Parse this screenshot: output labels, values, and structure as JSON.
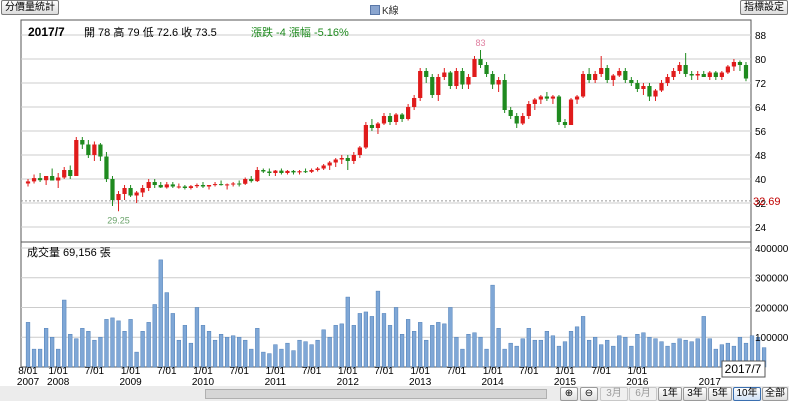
{
  "toolbar": {
    "left_button": "分價量統計",
    "right_button": "指標設定",
    "legend_label": "K線"
  },
  "header": {
    "period": "2017/7",
    "ohlc_text": "開 78  高 79  低 72.6  收 73.5",
    "change_text": "漲跌 -4  漲幅  -5.16%"
  },
  "volume_panel": {
    "label": "成交量 69,156 張"
  },
  "colors": {
    "up": "#e01b1b",
    "down": "#1f8a1f",
    "volume_bar": "#7fa7d6",
    "grid": "#cccccc"
  },
  "chart_data": [
    {
      "type": "candlestick",
      "title": "K線",
      "interval": "monthly",
      "price_axis_ticks": [
        24,
        32,
        40,
        48,
        56,
        64,
        72,
        80,
        88
      ],
      "ylim": [
        19,
        93
      ],
      "annotations": {
        "high": 83,
        "low": 29.25,
        "last_price": "32.69"
      },
      "x_tick_labels": [
        "8/01",
        "1/01",
        "7/01",
        "1/01",
        "7/01",
        "1/01",
        "7/01",
        "1/01",
        "7/01",
        "1/01",
        "7/01",
        "1/01",
        "7/01",
        "1/01",
        "7/01",
        "1/01",
        "7/01",
        "1/01"
      ],
      "x_year_labels": [
        "2007",
        "2008",
        "2009",
        "2010",
        "2011",
        "2012",
        "2013",
        "2014",
        "2015",
        "2016",
        "2017"
      ],
      "current_label": "2017/7",
      "candles": [
        {
          "d": "2007/08",
          "o": 38.5,
          "h": 40,
          "l": 37.5,
          "c": 39.2
        },
        {
          "d": "2007/09",
          "o": 39.2,
          "h": 41.5,
          "l": 38.5,
          "c": 40.3
        },
        {
          "d": "2007/10",
          "o": 40.3,
          "h": 42,
          "l": 39,
          "c": 39.6
        },
        {
          "d": "2007/11",
          "o": 39.6,
          "h": 41,
          "l": 38,
          "c": 41
        },
        {
          "d": "2007/12",
          "o": 41,
          "h": 43.5,
          "l": 40.5,
          "c": 39.5
        },
        {
          "d": "2008/01",
          "o": 39.5,
          "h": 42,
          "l": 37,
          "c": 40.5
        },
        {
          "d": "2008/02",
          "o": 40.5,
          "h": 44,
          "l": 40,
          "c": 43
        },
        {
          "d": "2008/03",
          "o": 43,
          "h": 44.5,
          "l": 40,
          "c": 41
        },
        {
          "d": "2008/04",
          "o": 41,
          "h": 54,
          "l": 41,
          "c": 53
        },
        {
          "d": "2008/05",
          "o": 53,
          "h": 54,
          "l": 50,
          "c": 51.5
        },
        {
          "d": "2008/06",
          "o": 51.5,
          "h": 53,
          "l": 47,
          "c": 48
        },
        {
          "d": "2008/07",
          "o": 48,
          "h": 52.5,
          "l": 46,
          "c": 51.5
        },
        {
          "d": "2008/08",
          "o": 51.5,
          "h": 52,
          "l": 46,
          "c": 47.5
        },
        {
          "d": "2008/09",
          "o": 47.5,
          "h": 49,
          "l": 39,
          "c": 40
        },
        {
          "d": "2008/10",
          "o": 40,
          "h": 41,
          "l": 31,
          "c": 33
        },
        {
          "d": "2008/11",
          "o": 33,
          "h": 36,
          "l": 29.25,
          "c": 35
        },
        {
          "d": "2008/12",
          "o": 35,
          "h": 38,
          "l": 33,
          "c": 37
        },
        {
          "d": "2009/01",
          "o": 37,
          "h": 38,
          "l": 34,
          "c": 34.5
        },
        {
          "d": "2009/02",
          "o": 34.5,
          "h": 36,
          "l": 32,
          "c": 35.5
        },
        {
          "d": "2009/03",
          "o": 35.5,
          "h": 38,
          "l": 34,
          "c": 37
        },
        {
          "d": "2009/04",
          "o": 37,
          "h": 40,
          "l": 36,
          "c": 39
        },
        {
          "d": "2009/05",
          "o": 39,
          "h": 40,
          "l": 37,
          "c": 38
        },
        {
          "d": "2009/06",
          "o": 38,
          "h": 39,
          "l": 37,
          "c": 37.2
        },
        {
          "d": "2009/07",
          "o": 37.2,
          "h": 39,
          "l": 36.8,
          "c": 38.2
        },
        {
          "d": "2009/08",
          "o": 38.2,
          "h": 39,
          "l": 37,
          "c": 37.5
        },
        {
          "d": "2009/09",
          "o": 37.5,
          "h": 38.5,
          "l": 36.8,
          "c": 37.5
        },
        {
          "d": "2009/10",
          "o": 37.5,
          "h": 38,
          "l": 36.5,
          "c": 37
        },
        {
          "d": "2009/11",
          "o": 37,
          "h": 38,
          "l": 36.5,
          "c": 37.6
        },
        {
          "d": "2009/12",
          "o": 37.6,
          "h": 38.5,
          "l": 37,
          "c": 38
        },
        {
          "d": "2010/01",
          "o": 38,
          "h": 39,
          "l": 37,
          "c": 37.5
        },
        {
          "d": "2010/02",
          "o": 37.5,
          "h": 38,
          "l": 36.5,
          "c": 38
        },
        {
          "d": "2010/03",
          "o": 38,
          "h": 39,
          "l": 37.5,
          "c": 38.3
        },
        {
          "d": "2010/04",
          "o": 38.3,
          "h": 39.5,
          "l": 37.8,
          "c": 38
        },
        {
          "d": "2010/05",
          "o": 38,
          "h": 38.5,
          "l": 36.5,
          "c": 38.2
        },
        {
          "d": "2010/06",
          "o": 38.2,
          "h": 39,
          "l": 37.5,
          "c": 38.5
        },
        {
          "d": "2010/07",
          "o": 38.5,
          "h": 39.5,
          "l": 37.5,
          "c": 38.4
        },
        {
          "d": "2010/08",
          "o": 38.4,
          "h": 40.5,
          "l": 38,
          "c": 40
        },
        {
          "d": "2010/09",
          "o": 40,
          "h": 41,
          "l": 38.8,
          "c": 39.3
        },
        {
          "d": "2010/10",
          "o": 39.3,
          "h": 44,
          "l": 39,
          "c": 43
        },
        {
          "d": "2010/11",
          "o": 43,
          "h": 43.5,
          "l": 42,
          "c": 42.5
        },
        {
          "d": "2010/12",
          "o": 42.5,
          "h": 43.5,
          "l": 41,
          "c": 42
        },
        {
          "d": "2011/01",
          "o": 42,
          "h": 43,
          "l": 41,
          "c": 42.8
        },
        {
          "d": "2011/02",
          "o": 42.8,
          "h": 43.5,
          "l": 41.5,
          "c": 42
        },
        {
          "d": "2011/03",
          "o": 42,
          "h": 43,
          "l": 41.5,
          "c": 42.7
        },
        {
          "d": "2011/04",
          "o": 42.7,
          "h": 43,
          "l": 41.5,
          "c": 42.2
        },
        {
          "d": "2011/05",
          "o": 42.2,
          "h": 43,
          "l": 41.5,
          "c": 42.6
        },
        {
          "d": "2011/06",
          "o": 42.6,
          "h": 43.5,
          "l": 42,
          "c": 42.4
        },
        {
          "d": "2011/07",
          "o": 42.4,
          "h": 43.5,
          "l": 42,
          "c": 43
        },
        {
          "d": "2011/08",
          "o": 43,
          "h": 44,
          "l": 42.5,
          "c": 43.5
        },
        {
          "d": "2011/09",
          "o": 43.5,
          "h": 45,
          "l": 43,
          "c": 44.5
        },
        {
          "d": "2011/10",
          "o": 44.5,
          "h": 46,
          "l": 43,
          "c": 45.5
        },
        {
          "d": "2011/11",
          "o": 45.5,
          "h": 47,
          "l": 44,
          "c": 46.5
        },
        {
          "d": "2011/12",
          "o": 46.5,
          "h": 48,
          "l": 45,
          "c": 47
        },
        {
          "d": "2012/01",
          "o": 47,
          "h": 48,
          "l": 43,
          "c": 46
        },
        {
          "d": "2012/02",
          "o": 46,
          "h": 49,
          "l": 45,
          "c": 48
        },
        {
          "d": "2012/03",
          "o": 48,
          "h": 51,
          "l": 47,
          "c": 50.5
        },
        {
          "d": "2012/04",
          "o": 50.5,
          "h": 59,
          "l": 50,
          "c": 58
        },
        {
          "d": "2012/05",
          "o": 58,
          "h": 60,
          "l": 56,
          "c": 57
        },
        {
          "d": "2012/06",
          "o": 57,
          "h": 59,
          "l": 55,
          "c": 58.5
        },
        {
          "d": "2012/07",
          "o": 58.5,
          "h": 62,
          "l": 58,
          "c": 61
        },
        {
          "d": "2012/08",
          "o": 61,
          "h": 62,
          "l": 58,
          "c": 59
        },
        {
          "d": "2012/09",
          "o": 59,
          "h": 62,
          "l": 58,
          "c": 61.5
        },
        {
          "d": "2012/10",
          "o": 61.5,
          "h": 62,
          "l": 59,
          "c": 60
        },
        {
          "d": "2012/11",
          "o": 60,
          "h": 65,
          "l": 59.5,
          "c": 64
        },
        {
          "d": "2012/12",
          "o": 64,
          "h": 68,
          "l": 63,
          "c": 67
        },
        {
          "d": "2013/01",
          "o": 67,
          "h": 77,
          "l": 66,
          "c": 76
        },
        {
          "d": "2013/02",
          "o": 76,
          "h": 77,
          "l": 72,
          "c": 74
        },
        {
          "d": "2013/03",
          "o": 74,
          "h": 75,
          "l": 67,
          "c": 68
        },
        {
          "d": "2013/04",
          "o": 68,
          "h": 75,
          "l": 66,
          "c": 74
        },
        {
          "d": "2013/05",
          "o": 74,
          "h": 77,
          "l": 73,
          "c": 75.5
        },
        {
          "d": "2013/06",
          "o": 75.5,
          "h": 76,
          "l": 70,
          "c": 71
        },
        {
          "d": "2013/07",
          "o": 71,
          "h": 77,
          "l": 70,
          "c": 76
        },
        {
          "d": "2013/08",
          "o": 76,
          "h": 77,
          "l": 70,
          "c": 71.5
        },
        {
          "d": "2013/09",
          "o": 71.5,
          "h": 75,
          "l": 70,
          "c": 74
        },
        {
          "d": "2013/10",
          "o": 74,
          "h": 81,
          "l": 74,
          "c": 80
        },
        {
          "d": "2013/11",
          "o": 80,
          "h": 83,
          "l": 77,
          "c": 78
        },
        {
          "d": "2013/12",
          "o": 78,
          "h": 79,
          "l": 74,
          "c": 75
        },
        {
          "d": "2014/01",
          "o": 75,
          "h": 76,
          "l": 70,
          "c": 71.5
        },
        {
          "d": "2014/02",
          "o": 71.5,
          "h": 74,
          "l": 69,
          "c": 73
        },
        {
          "d": "2014/03",
          "o": 73,
          "h": 75,
          "l": 62,
          "c": 63
        },
        {
          "d": "2014/04",
          "o": 63,
          "h": 64,
          "l": 60,
          "c": 61
        },
        {
          "d": "2014/05",
          "o": 61,
          "h": 62,
          "l": 57,
          "c": 58.5
        },
        {
          "d": "2014/06",
          "o": 58.5,
          "h": 62,
          "l": 58,
          "c": 61
        },
        {
          "d": "2014/07",
          "o": 61,
          "h": 66,
          "l": 60,
          "c": 65
        },
        {
          "d": "2014/08",
          "o": 65,
          "h": 67,
          "l": 63,
          "c": 66.5
        },
        {
          "d": "2014/09",
          "o": 66.5,
          "h": 68,
          "l": 65,
          "c": 67.5
        },
        {
          "d": "2014/10",
          "o": 67.5,
          "h": 69,
          "l": 66,
          "c": 66.8
        },
        {
          "d": "2014/11",
          "o": 66.8,
          "h": 68,
          "l": 65,
          "c": 67.5
        },
        {
          "d": "2014/12",
          "o": 67.5,
          "h": 68,
          "l": 58,
          "c": 59
        },
        {
          "d": "2015/01",
          "o": 59,
          "h": 60,
          "l": 57,
          "c": 58
        },
        {
          "d": "2015/02",
          "o": 58,
          "h": 67,
          "l": 58,
          "c": 66.5
        },
        {
          "d": "2015/03",
          "o": 66.5,
          "h": 68,
          "l": 65,
          "c": 67.5
        },
        {
          "d": "2015/04",
          "o": 67.5,
          "h": 76,
          "l": 67,
          "c": 75
        },
        {
          "d": "2015/05",
          "o": 75,
          "h": 77,
          "l": 72,
          "c": 73
        },
        {
          "d": "2015/06",
          "o": 73,
          "h": 76,
          "l": 72,
          "c": 75
        },
        {
          "d": "2015/07",
          "o": 75,
          "h": 81,
          "l": 74,
          "c": 77
        },
        {
          "d": "2015/08",
          "o": 77,
          "h": 78,
          "l": 72,
          "c": 73
        },
        {
          "d": "2015/09",
          "o": 73,
          "h": 75,
          "l": 71,
          "c": 74.5
        },
        {
          "d": "2015/10",
          "o": 74.5,
          "h": 77,
          "l": 74,
          "c": 76
        },
        {
          "d": "2015/11",
          "o": 76,
          "h": 77,
          "l": 72,
          "c": 73
        },
        {
          "d": "2015/12",
          "o": 73,
          "h": 74,
          "l": 71,
          "c": 72
        },
        {
          "d": "2016/01",
          "o": 72,
          "h": 73,
          "l": 69,
          "c": 70
        },
        {
          "d": "2016/02",
          "o": 70,
          "h": 72,
          "l": 68,
          "c": 71
        },
        {
          "d": "2016/03",
          "o": 71,
          "h": 72,
          "l": 66,
          "c": 67.5
        },
        {
          "d": "2016/04",
          "o": 67.5,
          "h": 70,
          "l": 66,
          "c": 69.5
        },
        {
          "d": "2016/05",
          "o": 69.5,
          "h": 73,
          "l": 69,
          "c": 72
        },
        {
          "d": "2016/06",
          "o": 72,
          "h": 75,
          "l": 71,
          "c": 74
        },
        {
          "d": "2016/07",
          "o": 74,
          "h": 77,
          "l": 73,
          "c": 76
        },
        {
          "d": "2016/08",
          "o": 76,
          "h": 79,
          "l": 75,
          "c": 78
        },
        {
          "d": "2016/09",
          "o": 78,
          "h": 82,
          "l": 74,
          "c": 75
        },
        {
          "d": "2016/10",
          "o": 75,
          "h": 76,
          "l": 73,
          "c": 74.5
        },
        {
          "d": "2016/11",
          "o": 74.5,
          "h": 76,
          "l": 73,
          "c": 75
        },
        {
          "d": "2016/12",
          "o": 75,
          "h": 76,
          "l": 74,
          "c": 74
        },
        {
          "d": "2017/01",
          "o": 74,
          "h": 76,
          "l": 73,
          "c": 75.5
        },
        {
          "d": "2017/02",
          "o": 75.5,
          "h": 76,
          "l": 73,
          "c": 74
        },
        {
          "d": "2017/03",
          "o": 74,
          "h": 76,
          "l": 73,
          "c": 75.5
        },
        {
          "d": "2017/04",
          "o": 75.5,
          "h": 78,
          "l": 75,
          "c": 77.5
        },
        {
          "d": "2017/05",
          "o": 77.5,
          "h": 80,
          "l": 76,
          "c": 79
        },
        {
          "d": "2017/06",
          "o": 79,
          "h": 79.5,
          "l": 76,
          "c": 78
        },
        {
          "d": "2017/07",
          "o": 78,
          "h": 79,
          "l": 72.6,
          "c": 73.5
        }
      ]
    },
    {
      "type": "bar",
      "title": "成交量",
      "y_ticks": [
        100000,
        200000,
        300000,
        400000
      ],
      "y_tick_labels": [
        "100000",
        "200000",
        "300000",
        "400000"
      ],
      "ylim": [
        0,
        420000
      ],
      "values": [
        150000,
        60000,
        60000,
        130000,
        100000,
        60000,
        225000,
        110000,
        95000,
        130000,
        120000,
        90000,
        100000,
        160000,
        165000,
        155000,
        120000,
        160000,
        50000,
        120000,
        150000,
        210000,
        360000,
        250000,
        180000,
        90000,
        140000,
        80000,
        200000,
        140000,
        120000,
        90000,
        110000,
        100000,
        105000,
        100000,
        90000,
        60000,
        130000,
        50000,
        45000,
        75000,
        60000,
        80000,
        55000,
        90000,
        85000,
        75000,
        90000,
        125000,
        100000,
        140000,
        145000,
        235000,
        140000,
        180000,
        185000,
        170000,
        255000,
        180000,
        140000,
        200000,
        110000,
        160000,
        120000,
        150000,
        90000,
        140000,
        150000,
        145000,
        200000,
        100000,
        60000,
        110000,
        115000,
        100000,
        60000,
        275000,
        130000,
        60000,
        80000,
        70000,
        95000,
        130000,
        90000,
        90000,
        120000,
        105000,
        70000,
        85000,
        120000,
        135000,
        170000,
        90000,
        100000,
        75000,
        90000,
        70000,
        105000,
        100000,
        70000,
        110000,
        115000,
        100000,
        95000,
        85000,
        70000,
        80000,
        95000,
        90000,
        85000,
        95000,
        170000,
        95000,
        60000,
        75000,
        80000,
        70000,
        100000,
        80000,
        105000,
        100000,
        65000
      ]
    }
  ]
}
